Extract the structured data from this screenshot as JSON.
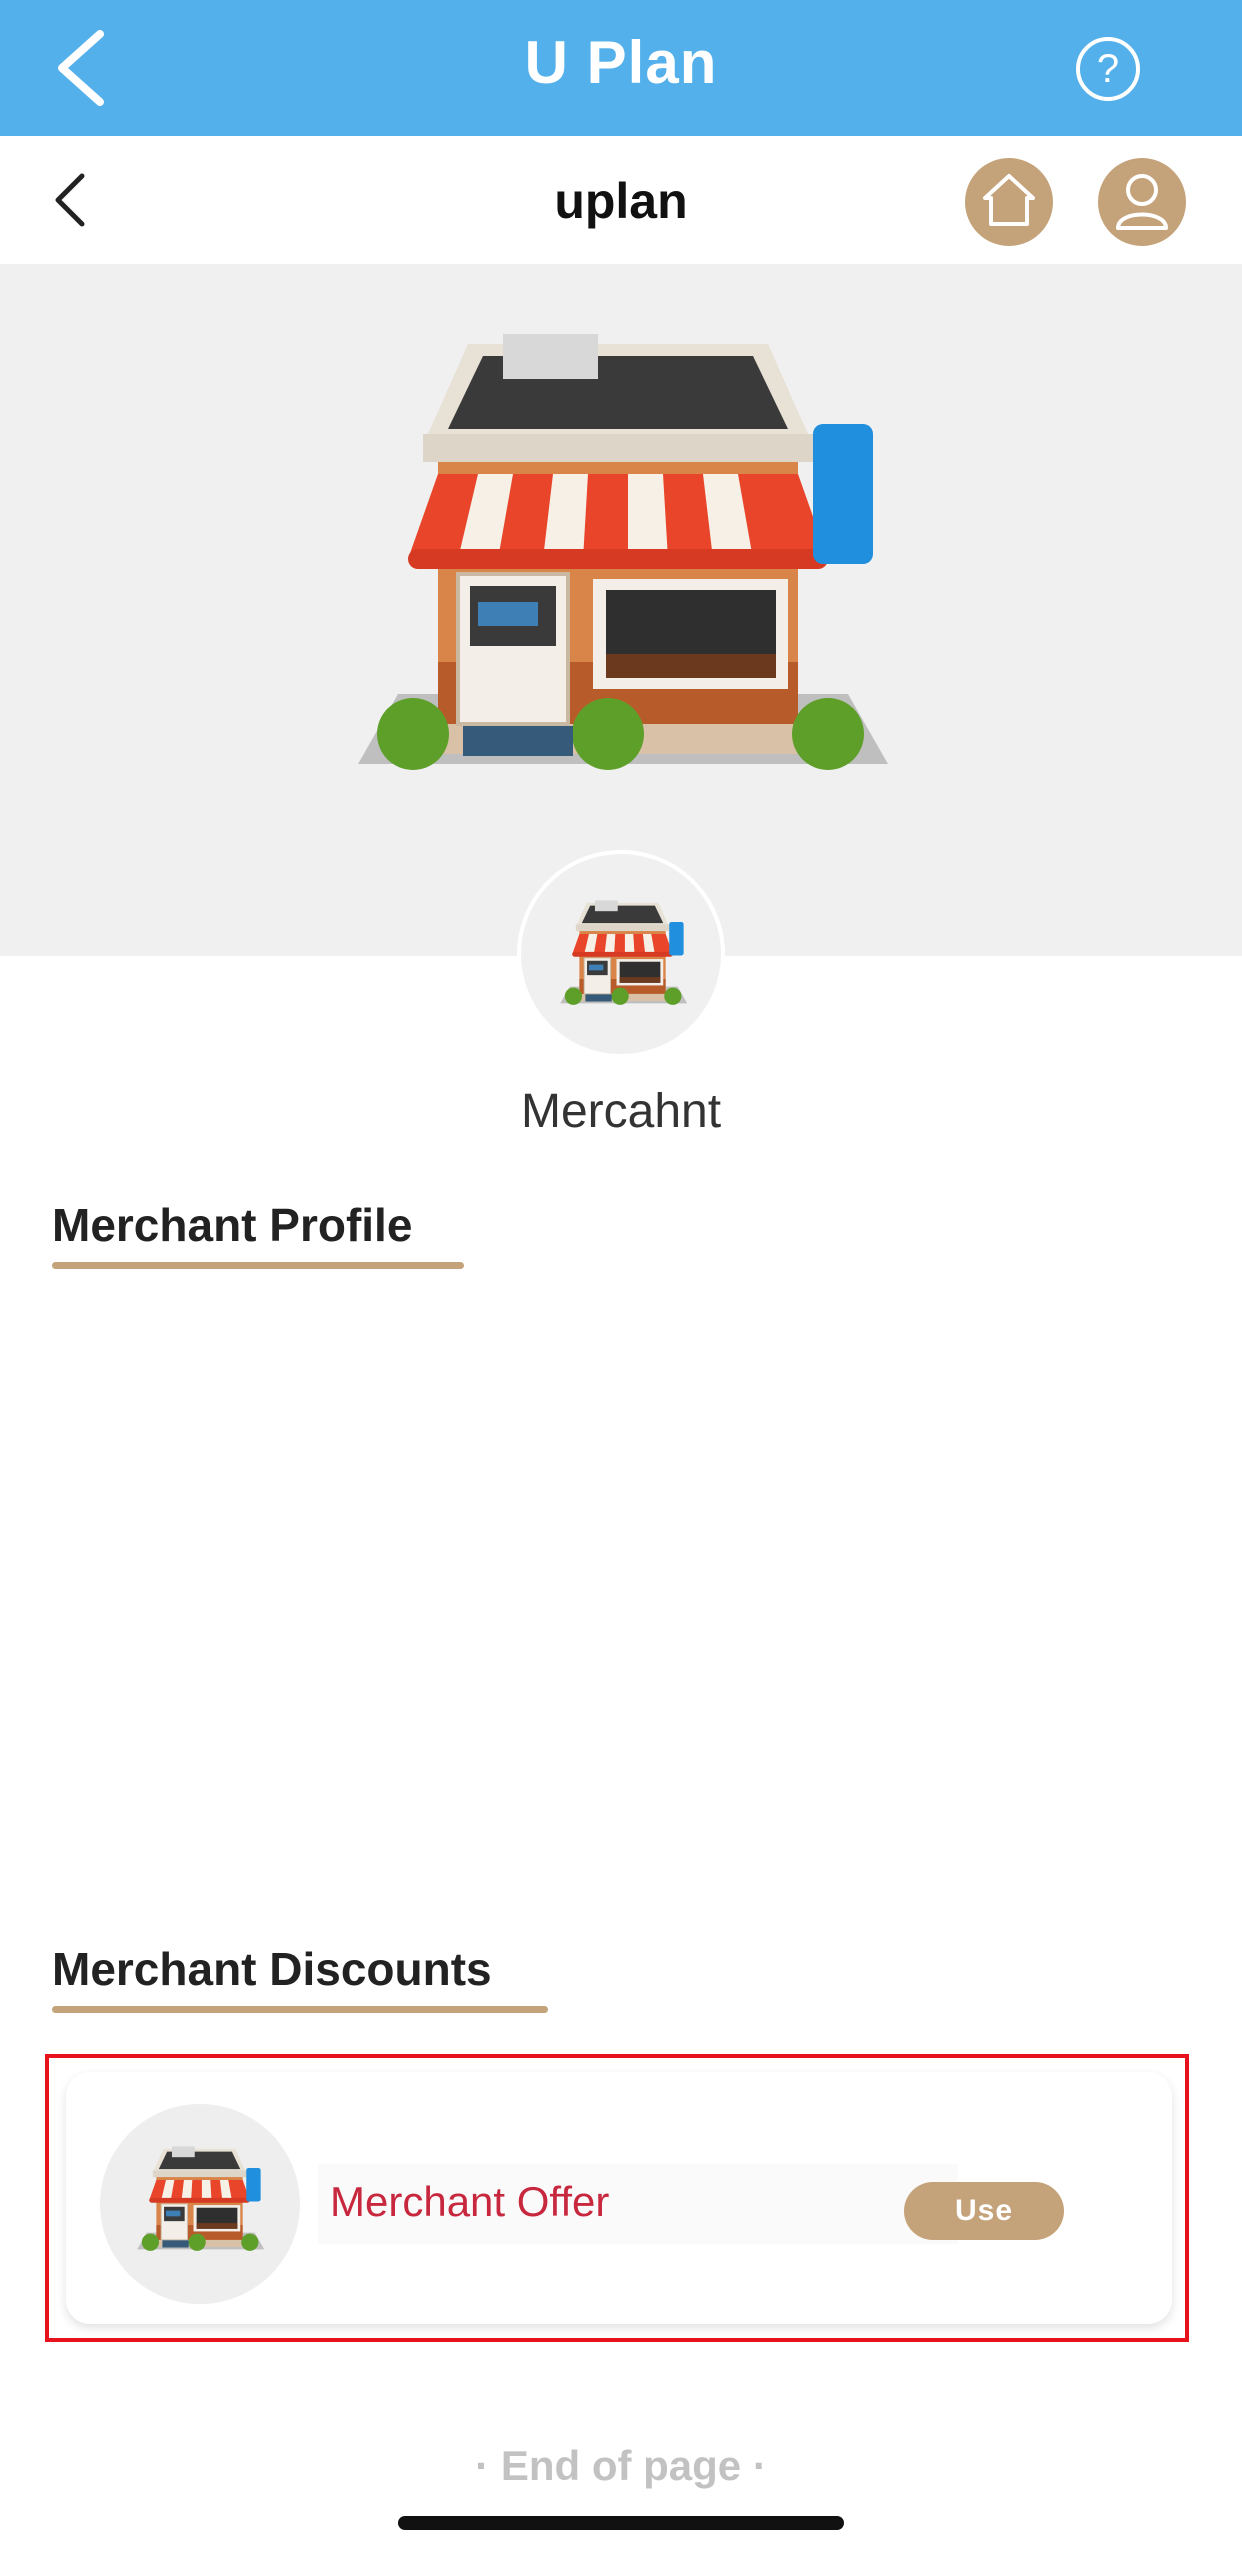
{
  "app": {
    "title": "U Plan",
    "brand_color": "#53b0ea",
    "help_label": "?"
  },
  "subnav": {
    "title": "uplan",
    "accent_color": "#c4a27a"
  },
  "merchant": {
    "name": "Mercahnt",
    "image_icon": "storefront-icon"
  },
  "sections": {
    "profile_title": "Merchant Profile",
    "discounts_title": "Merchant Discounts"
  },
  "discounts": [
    {
      "title": "Merchant Offer",
      "action_label": "Use",
      "title_color": "#c8283e"
    }
  ],
  "footer": {
    "end_text": "· End of page ·"
  },
  "highlight": {
    "color": "#e8121c"
  }
}
